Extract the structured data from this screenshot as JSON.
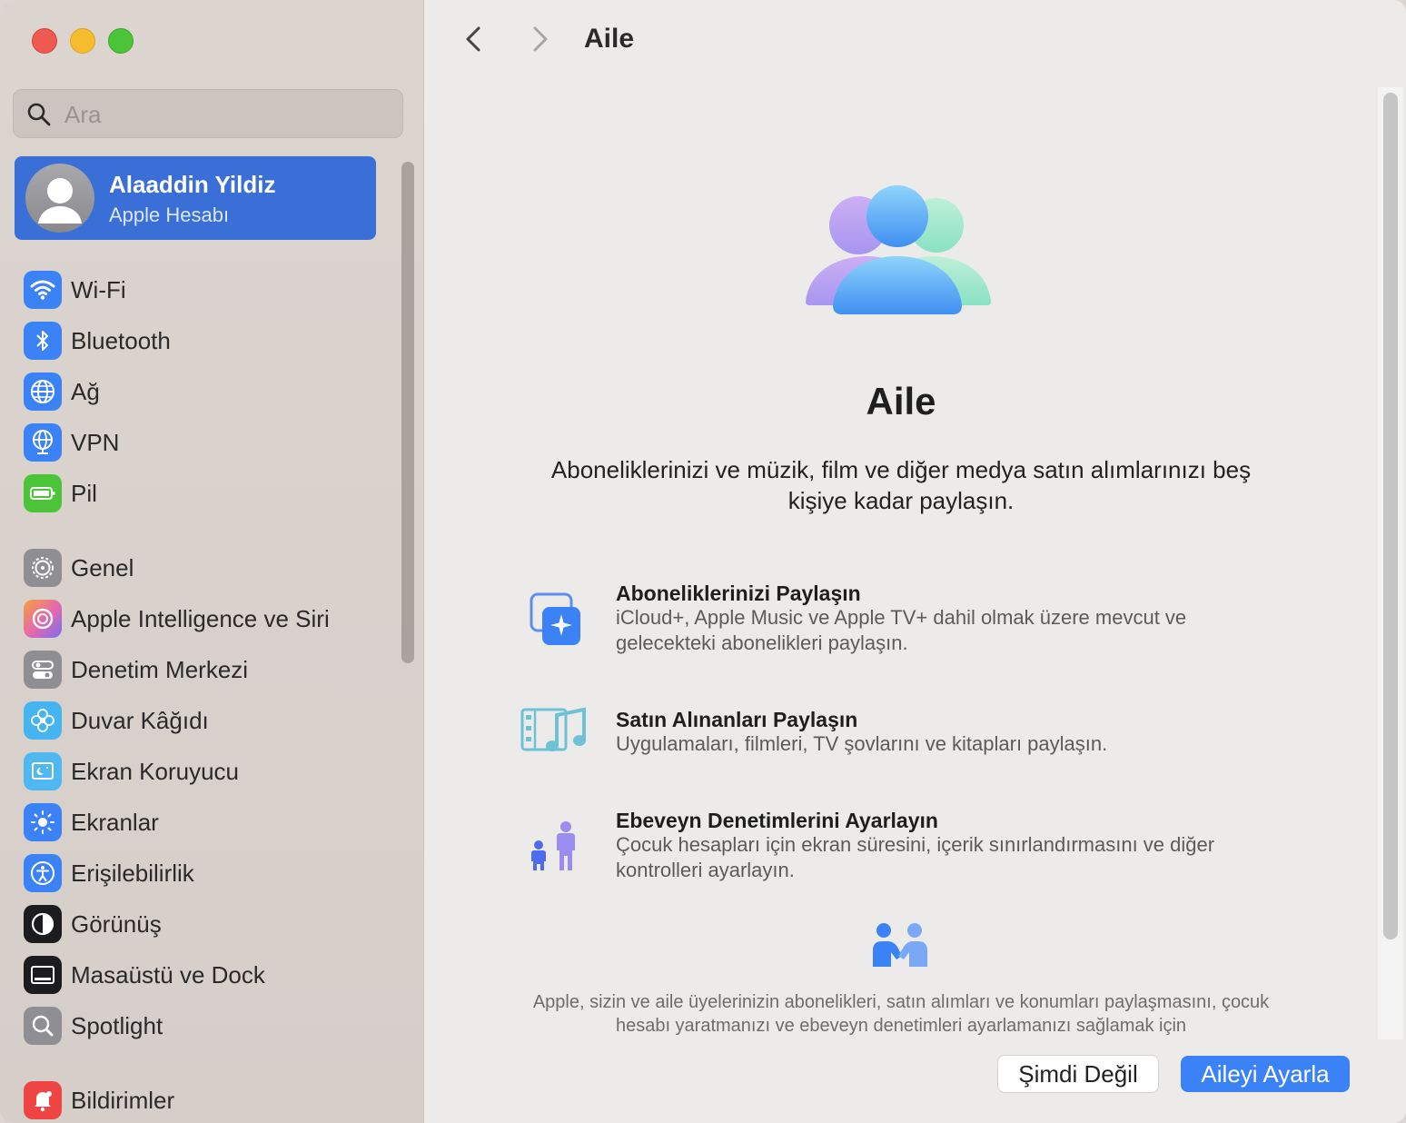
{
  "sidebar": {
    "search_placeholder": "Ara",
    "account": {
      "name": "Alaaddin Yildiz",
      "subtitle": "Apple Hesabı"
    },
    "items": [
      {
        "label": "Wi-Fi",
        "icon": "wifi-icon",
        "color": "#3b82f6"
      },
      {
        "label": "Bluetooth",
        "icon": "bluetooth-icon",
        "color": "#3b82f6"
      },
      {
        "label": "Ağ",
        "icon": "globe-icon",
        "color": "#3b82f6"
      },
      {
        "label": "VPN",
        "icon": "vpn-globe-icon",
        "color": "#3b82f6"
      },
      {
        "label": "Pil",
        "icon": "battery-icon",
        "color": "#4cc43a"
      },
      {
        "label": "Genel",
        "icon": "gear-icon",
        "color": "#8e8e93"
      },
      {
        "label": "Apple Intelligence ve Siri",
        "icon": "siri-icon",
        "color": "#e86aa8"
      },
      {
        "label": "Denetim Merkezi",
        "icon": "control-center-icon",
        "color": "#8e8e93"
      },
      {
        "label": "Duvar Kâğıdı",
        "icon": "wallpaper-flower-icon",
        "color": "#45b4f0"
      },
      {
        "label": "Ekran Koruyucu",
        "icon": "screensaver-icon",
        "color": "#4fb8f0"
      },
      {
        "label": "Ekranlar",
        "icon": "brightness-icon",
        "color": "#3b82f6"
      },
      {
        "label": "Erişilebilirlik",
        "icon": "accessibility-icon",
        "color": "#3b82f6"
      },
      {
        "label": "Görünüş",
        "icon": "appearance-icon",
        "color": "#1c1c1e"
      },
      {
        "label": "Masaüstü ve Dock",
        "icon": "dock-icon",
        "color": "#1c1c1e"
      },
      {
        "label": "Spotlight",
        "icon": "magnifier-icon",
        "color": "#8e8e93"
      },
      {
        "label": "Bildirimler",
        "icon": "bell-icon",
        "color": "#ef4444"
      }
    ]
  },
  "main": {
    "title": "Aile",
    "hero_title": "Aile",
    "hero_description": "Aboneliklerinizi ve müzik, film ve diğer medya satın alımlarınızı beş kişiye kadar paylaşın.",
    "features": [
      {
        "title": "Aboneliklerinizi Paylaşın",
        "description": "iCloud+, Apple Music ve Apple TV+ dahil olmak üzere mevcut ve gelecekteki abonelikleri paylaşın.",
        "icon": "subscriptions-icon"
      },
      {
        "title": "Satın Alınanları Paylaşın",
        "description": "Uygulamaları, filmleri, TV şovlarını ve kitapları paylaşın.",
        "icon": "media-purchases-icon"
      },
      {
        "title": "Ebeveyn Denetimlerini Ayarlayın",
        "description": "Çocuk hesapları için ekran süresini, içerik sınırlandırmasını ve diğer kontrolleri ayarlayın.",
        "icon": "parental-controls-icon"
      }
    ],
    "privacy_text": "Apple, sizin ve aile üyelerinizin abonelikleri, satın alımları ve konumları paylaşmasını, çocuk hesabı yaratmanızı ve ebeveyn denetimleri ayarlamanızı sağlamak için",
    "buttons": {
      "secondary": "Şimdi Değil",
      "primary": "Aileyi Ayarla"
    },
    "accent_color": "#3b82f6"
  }
}
